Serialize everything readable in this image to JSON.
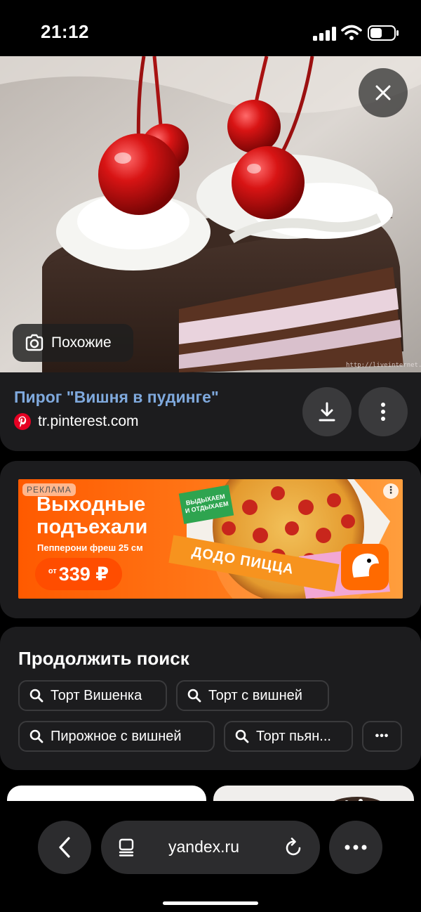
{
  "status_bar": {
    "time": "21:12"
  },
  "image": {
    "similar_label": "Похожие",
    "watermark": "http://liveinternet.ru"
  },
  "info": {
    "title": "Пирог \"Вишня в пудинге\"",
    "source": "tr.pinterest.com"
  },
  "ad": {
    "tag": "РЕКЛАМА",
    "headline_line1": "Выходные",
    "headline_line2": "подъехали",
    "subline": "Пепперони фреш 25 см",
    "price_prefix": "от",
    "price": "339 ₽",
    "badge_line1": "ВЫДЫХАЕМ",
    "badge_line2": "И ОТДЫХАЕМ",
    "brand": "ДОДО ПИЦЦА",
    "brand_colors": {
      "orange": "#ff6a00",
      "green": "#2ea44f"
    }
  },
  "continue_search": {
    "title": "Продолжить поиск",
    "chips": [
      {
        "label": "Торт Вишенка"
      },
      {
        "label": "Торт с вишней"
      },
      {
        "label": "Пирожное с вишней"
      },
      {
        "label": "Торт пьян..."
      }
    ],
    "more_label": "•••"
  },
  "browser": {
    "url": "yandex.ru"
  },
  "colors": {
    "background": "#000000",
    "card": "#1c1c1e",
    "button": "#3a3a3c",
    "link": "#7fa9dd",
    "pinterest": "#e60023"
  }
}
